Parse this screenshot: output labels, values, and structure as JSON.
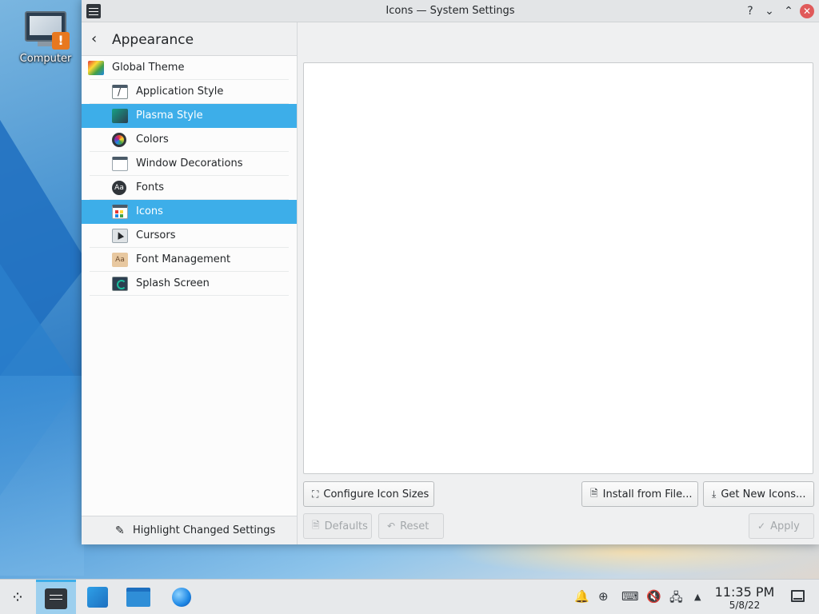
{
  "desktop": {
    "icons": [
      {
        "label": "Computer",
        "icon": "computer-warning-icon"
      }
    ]
  },
  "window": {
    "title": "Icons — System Settings",
    "controls": {
      "help": "?",
      "minimize": "⌄",
      "maximize": "⌃",
      "close": "✕"
    }
  },
  "sidebar": {
    "back_icon": "‹",
    "heading": "Appearance",
    "items": [
      {
        "label": "Global Theme",
        "icon": "global-theme-icon",
        "selected": false
      },
      {
        "label": "Application Style",
        "icon": "application-style-icon",
        "selected": false
      },
      {
        "label": "Plasma Style",
        "icon": "plasma-style-icon",
        "selected": true
      },
      {
        "label": "Colors",
        "icon": "colors-icon",
        "selected": false
      },
      {
        "label": "Window Decorations",
        "icon": "window-decorations-icon",
        "selected": false
      },
      {
        "label": "Fonts",
        "icon": "fonts-icon",
        "icon_text": "Aa",
        "selected": false
      },
      {
        "label": "Icons",
        "icon": "icons-icon",
        "selected": true
      },
      {
        "label": "Cursors",
        "icon": "cursors-icon",
        "selected": false
      },
      {
        "label": "Font Management",
        "icon": "font-management-icon",
        "icon_text": "Aa",
        "selected": false
      },
      {
        "label": "Splash Screen",
        "icon": "splash-screen-icon",
        "selected": false
      }
    ],
    "footer": {
      "label": "Highlight Changed Settings",
      "icon": "pen-icon"
    }
  },
  "main": {
    "buttons": {
      "configure": "Configure Icon Sizes",
      "install": "Install from File...",
      "get_new": "Get New Icons...",
      "defaults": "Defaults",
      "reset": "Reset",
      "apply": "Apply"
    }
  },
  "taskbar": {
    "apps": [
      "application-launcher-icon",
      "system-settings-icon",
      "discover-icon",
      "dolphin-files-icon",
      "web-browser-icon"
    ],
    "tray": [
      "notifications-icon",
      "update-icon",
      "keyboard-icon",
      "volume-muted-icon",
      "network-icon",
      "expand-tray-icon"
    ],
    "clock": {
      "time": "11:35 PM",
      "date": "5/8/22"
    }
  },
  "colors": {
    "accent": "#3daee9",
    "window_bg": "#eff0f1",
    "close_button": "#e05a5a"
  }
}
